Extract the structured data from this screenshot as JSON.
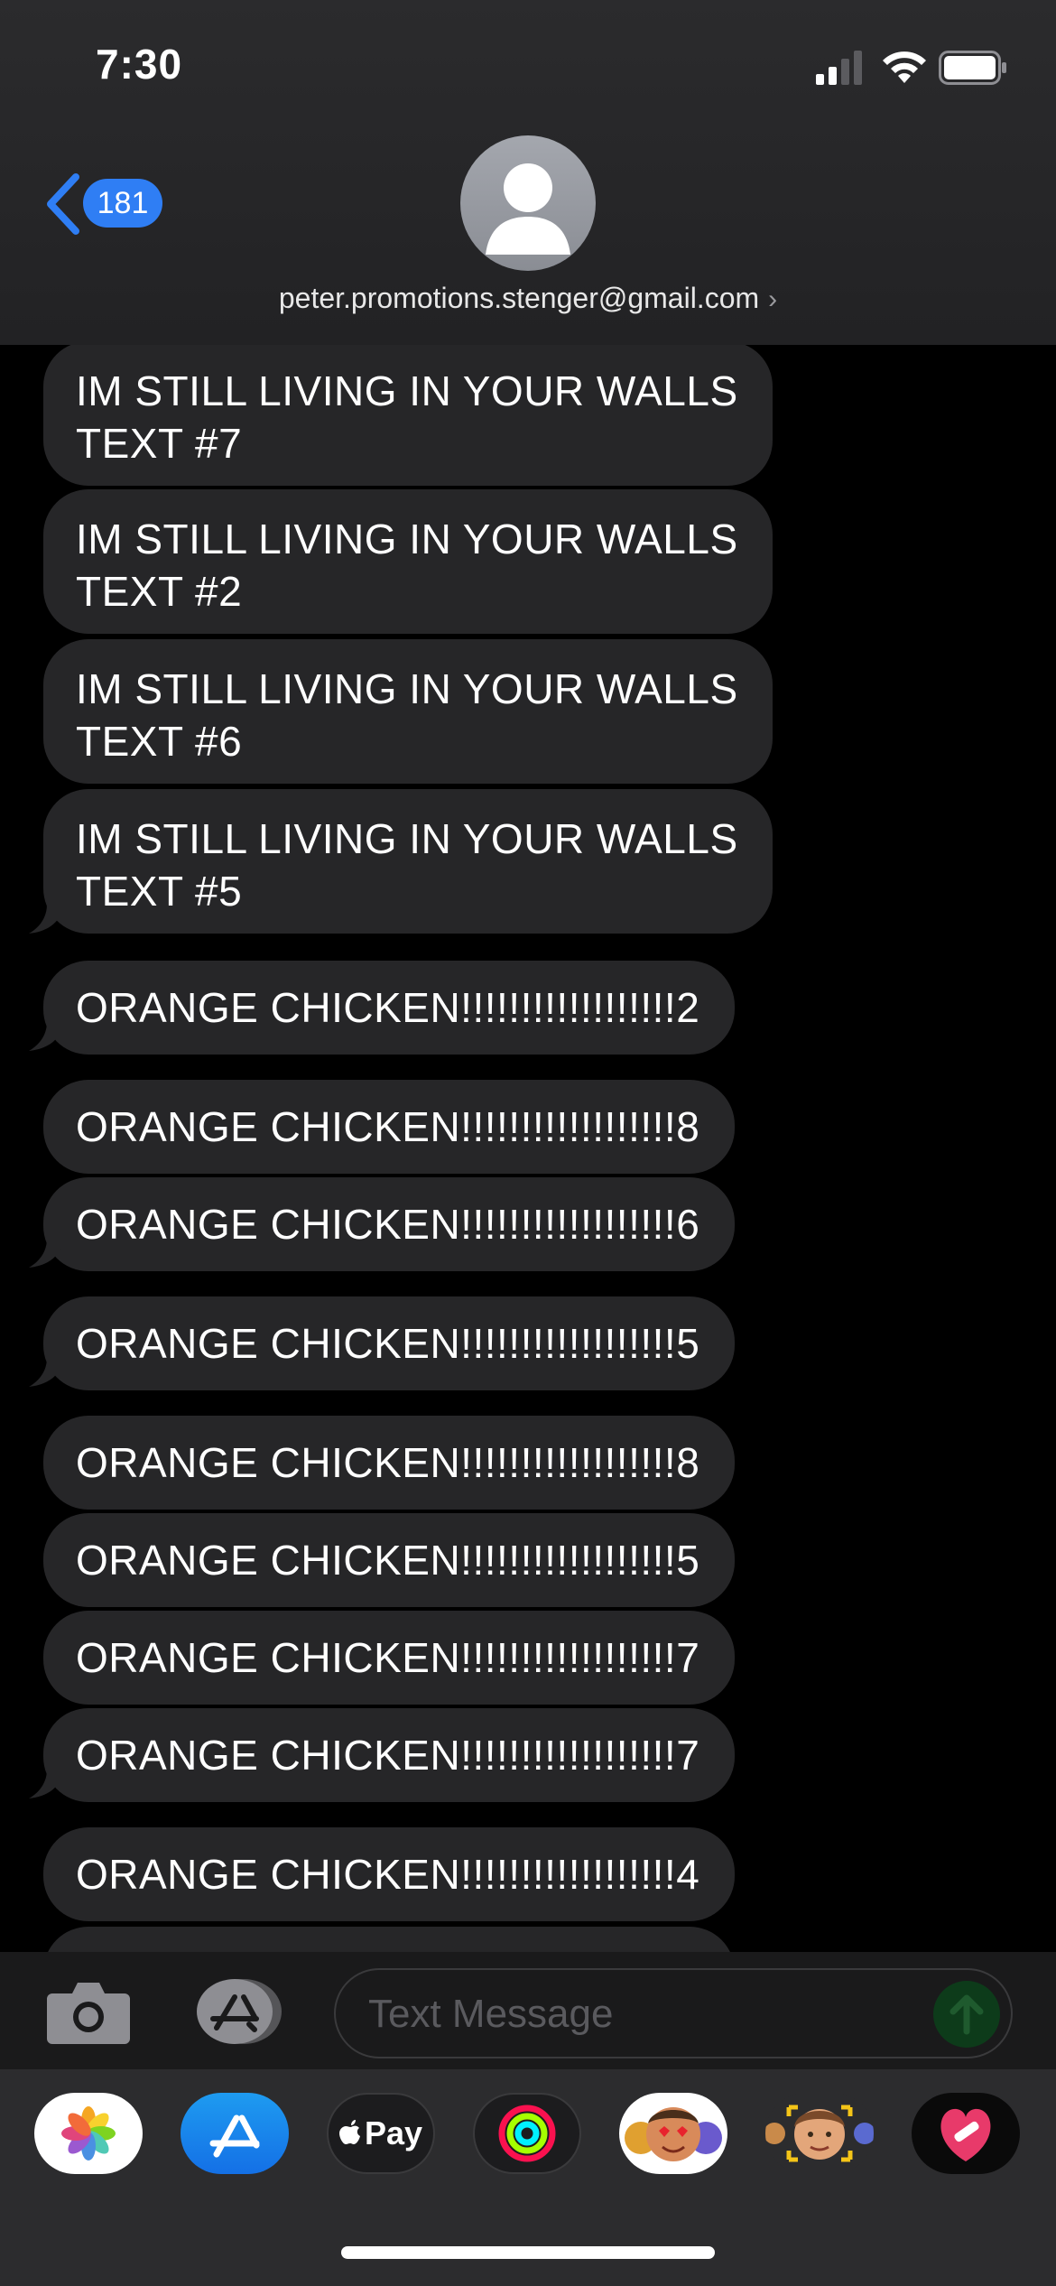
{
  "status_bar": {
    "time": "7:30"
  },
  "nav": {
    "back_count": "181",
    "contact": "peter.promotions.stenger@gmail.com",
    "chevron": "›"
  },
  "messages": [
    "IM STILL LIVING IN YOUR WALLS TEXT #7",
    "IM STILL LIVING IN YOUR WALLS TEXT #2",
    "IM STILL LIVING IN YOUR WALLS TEXT #6",
    "IM STILL LIVING IN YOUR WALLS TEXT #5",
    "ORANGE CHICKEN!!!!!!!!!!!!!!!!!!2",
    "ORANGE CHICKEN!!!!!!!!!!!!!!!!!!8",
    "ORANGE CHICKEN!!!!!!!!!!!!!!!!!!6",
    "ORANGE CHICKEN!!!!!!!!!!!!!!!!!!5",
    "ORANGE CHICKEN!!!!!!!!!!!!!!!!!!8",
    "ORANGE CHICKEN!!!!!!!!!!!!!!!!!!5",
    "ORANGE CHICKEN!!!!!!!!!!!!!!!!!!7",
    "ORANGE CHICKEN!!!!!!!!!!!!!!!!!!7",
    "ORANGE CHICKEN!!!!!!!!!!!!!!!!!!4"
  ],
  "composer": {
    "placeholder": "Text Message"
  },
  "apps": {
    "pay_label": "Pay"
  },
  "icons": [
    "signal-icon",
    "wifi-icon",
    "battery-icon",
    "back-chevron-icon",
    "contact-avatar-icon",
    "camera-icon",
    "app-store-icon",
    "send-arrow-icon",
    "photos-icon",
    "apple-pay-icon",
    "fitness-activity-icon",
    "animoji-icon",
    "memoji-icon",
    "heart-sticker-icon"
  ],
  "colors": {
    "accent": "#2f7ef4",
    "bubble": "#262628",
    "background": "#000000"
  }
}
